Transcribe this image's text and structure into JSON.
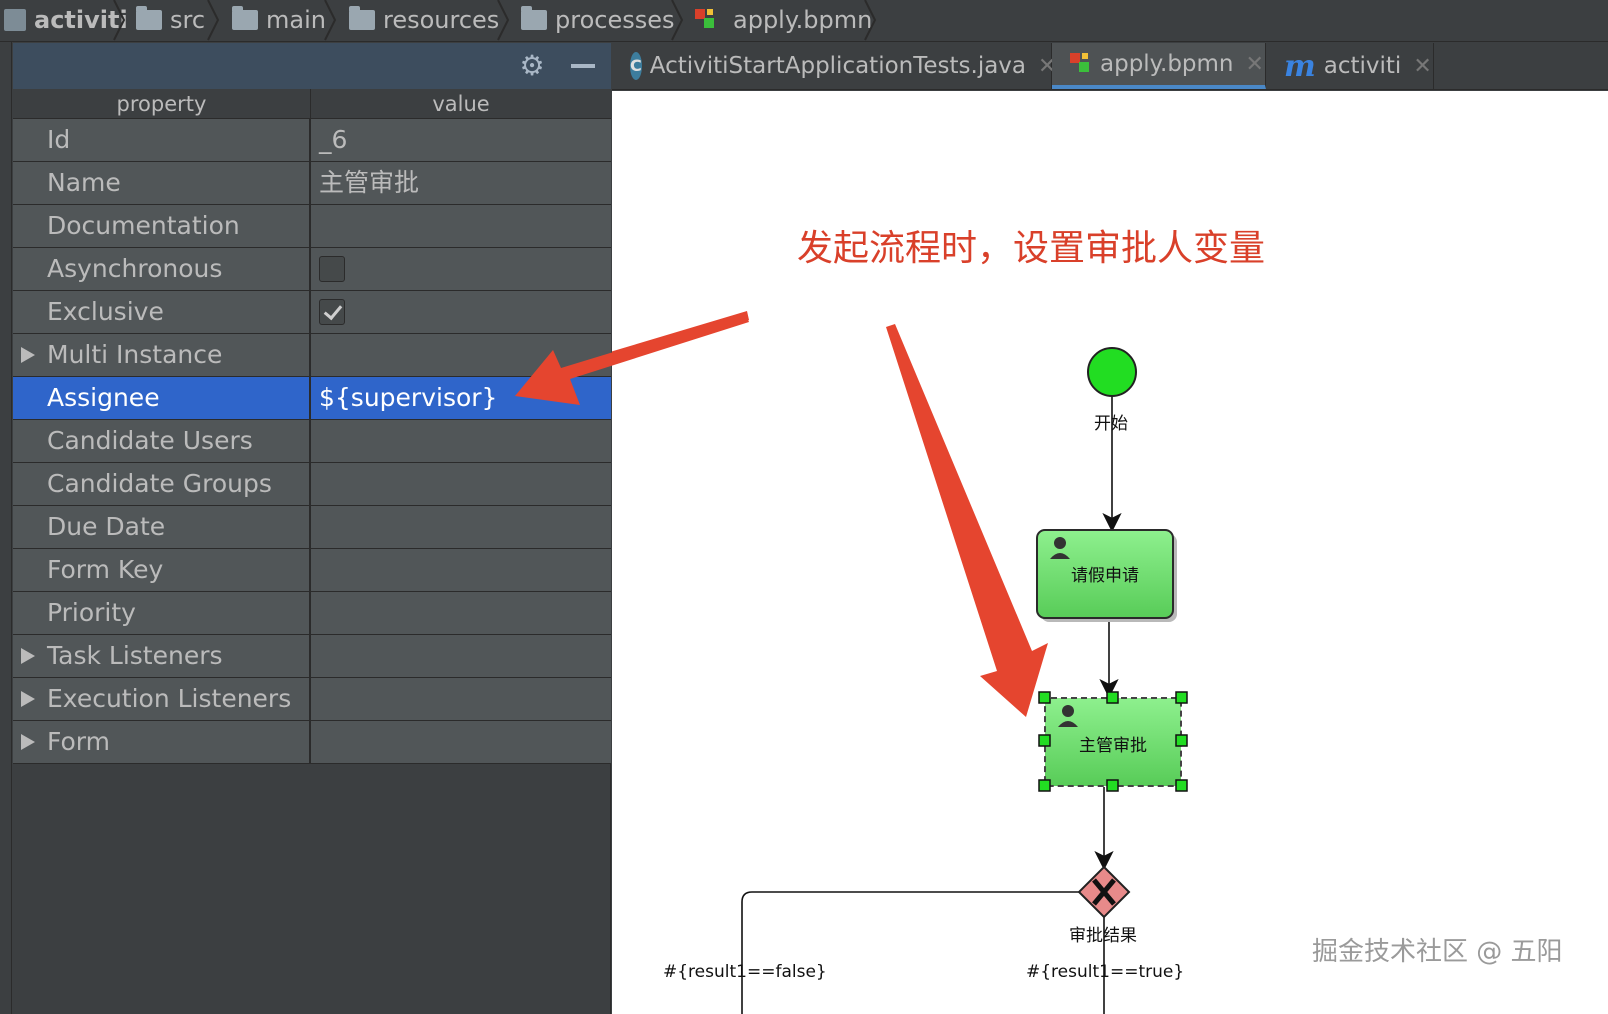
{
  "breadcrumb": {
    "items": [
      {
        "label": "activiti",
        "icon": "project-icon"
      },
      {
        "label": "src",
        "icon": "folder-icon"
      },
      {
        "label": "main",
        "icon": "folder-icon"
      },
      {
        "label": "resources",
        "icon": "resources-folder-icon"
      },
      {
        "label": "processes",
        "icon": "folder-icon"
      },
      {
        "label": "apply.bpmn",
        "icon": "bpmn-file-icon"
      }
    ]
  },
  "properties_panel": {
    "columns": {
      "property": "property",
      "value": "value"
    },
    "rows": [
      {
        "name": "Id",
        "value": "_6"
      },
      {
        "name": "Name",
        "value": "主管审批"
      },
      {
        "name": "Documentation",
        "value": ""
      },
      {
        "name": "Asynchronous",
        "checkbox": false
      },
      {
        "name": "Exclusive",
        "checkbox": true
      },
      {
        "name": "Multi Instance",
        "value": "",
        "expandable": true
      },
      {
        "name": "Assignee",
        "value": "${supervisor}",
        "selected": true
      },
      {
        "name": "Candidate Users",
        "value": ""
      },
      {
        "name": "Candidate Groups",
        "value": ""
      },
      {
        "name": "Due Date",
        "value": ""
      },
      {
        "name": "Form Key",
        "value": ""
      },
      {
        "name": "Priority",
        "value": ""
      },
      {
        "name": "Task Listeners",
        "value": "",
        "expandable": true
      },
      {
        "name": "Execution Listeners",
        "value": "",
        "expandable": true
      },
      {
        "name": "Form",
        "value": "",
        "expandable": true
      }
    ]
  },
  "tabs": [
    {
      "label": "ActivitiStartApplicationTests.java",
      "icon": "java-class-icon",
      "active": false
    },
    {
      "label": "apply.bpmn",
      "icon": "bpmn-file-icon",
      "active": true
    },
    {
      "label": "activiti",
      "icon": "maven-icon",
      "active": false
    }
  ],
  "diagram": {
    "annotation": "发起流程时，设置审批人变量",
    "start_event": "开始",
    "task_apply": "请假申请",
    "task_approve": "主管审批",
    "gateway": "审批结果",
    "flow_false": "#{result1==false}",
    "flow_true": "#{result1==true}",
    "watermark": "掘金技术社区 @ 五阳"
  },
  "colors": {
    "selection": "#2f65ca",
    "annotation_red": "#e5452f",
    "task_green": "#6fdc6f",
    "start_green": "#22dd22",
    "gateway_red": "#e88a8a"
  }
}
